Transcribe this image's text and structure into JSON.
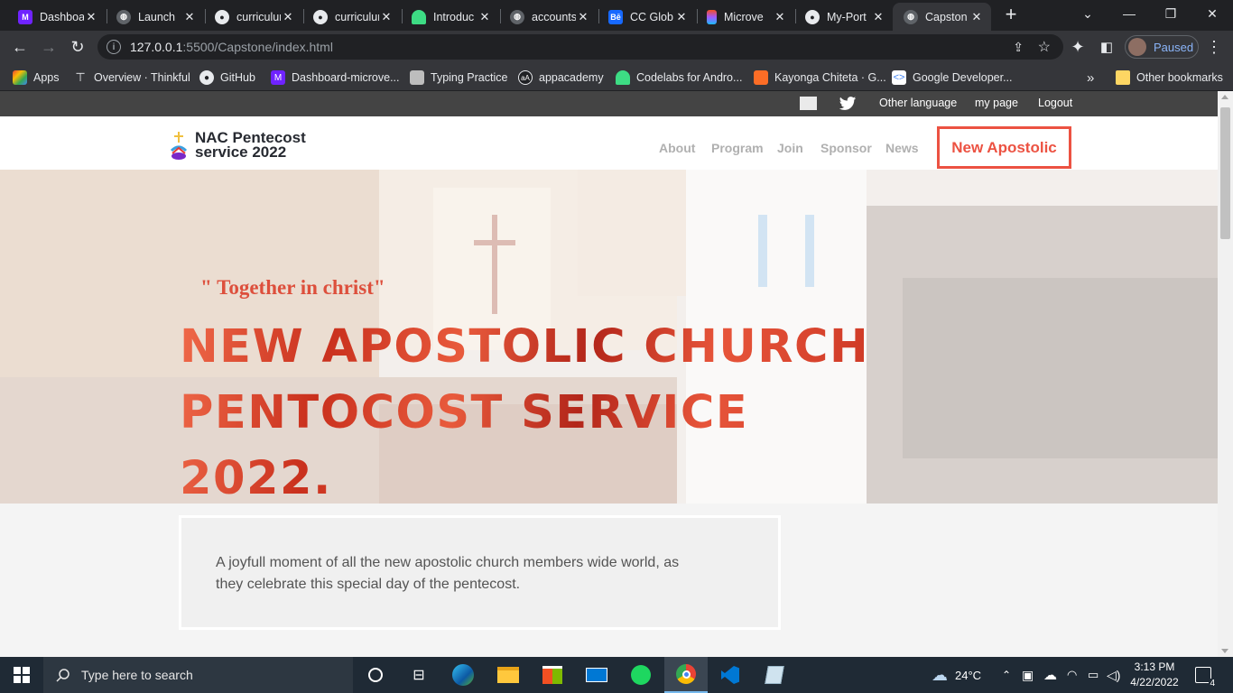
{
  "browser": {
    "tabs": [
      {
        "title": "Dashboard",
        "icon": "microverse-icon",
        "color": "#6f23ff"
      },
      {
        "title": "Launch",
        "icon": "globe-icon",
        "color": "#5f6368"
      },
      {
        "title": "curriculum",
        "icon": "github-icon",
        "color": "#24292e"
      },
      {
        "title": "curriculum",
        "icon": "github-icon",
        "color": "#24292e"
      },
      {
        "title": "Introduc",
        "icon": "android-icon",
        "color": "#3ddc84"
      },
      {
        "title": "accounts",
        "icon": "globe-icon",
        "color": "#5f6368"
      },
      {
        "title": "CC Glob",
        "icon": "behance-icon",
        "color": "#1769ff"
      },
      {
        "title": "Microve",
        "icon": "figma-icon",
        "color": "#f24e1e"
      },
      {
        "title": "My-Port",
        "icon": "github-icon",
        "color": "#24292e"
      },
      {
        "title": "Capston",
        "icon": "globe-icon",
        "color": "#5f6368",
        "active": true
      }
    ],
    "url_host": "127.0.0.1",
    "url_path": ":5500/Capstone/index.html",
    "profile_status": "Paused"
  },
  "bookmarks": [
    {
      "label": "Apps",
      "icon": "apps-grid-icon"
    },
    {
      "label": "Overview · Thinkful",
      "icon": "thinkful-icon"
    },
    {
      "label": "GitHub",
      "icon": "github-icon"
    },
    {
      "label": "Dashboard-microve...",
      "icon": "microverse-icon"
    },
    {
      "label": "Typing Practice",
      "icon": "typing-icon"
    },
    {
      "label": "appacademy",
      "icon": "appacademy-icon"
    },
    {
      "label": "Codelabs for Andro...",
      "icon": "android-icon"
    },
    {
      "label": "Kayonga Chiteta · G...",
      "icon": "gitlab-icon"
    },
    {
      "label": "Google Developer...",
      "icon": "google-dev-icon"
    }
  ],
  "bookmarks_overflow": "»",
  "other_bookmarks": "Other bookmarks",
  "page": {
    "topbar": {
      "links": [
        "Other language",
        "my page",
        "Logout"
      ]
    },
    "logo": {
      "line1": "NAC Pentecost",
      "line2": "service 2022"
    },
    "nav": [
      "About",
      "Program",
      "Join",
      "Sponsor",
      "News"
    ],
    "nav_cta": "New Apostolic",
    "hero": {
      "tagline": "\" Together in christ\"",
      "headline_1": "NEW APOSTOLIC CHURCH",
      "headline_2": "PENTOCOST SERVICE",
      "headline_3": "2022."
    },
    "intro": "A joyfull moment of all the new apostolic church members wide world, as they celebrate this special day of the pentecost.",
    "accent_color": "#ec5242"
  },
  "taskbar": {
    "search_placeholder": "Type here to search",
    "weather": "24°C",
    "time": "3:13 PM",
    "date": "4/22/2022",
    "notifications": "4"
  }
}
